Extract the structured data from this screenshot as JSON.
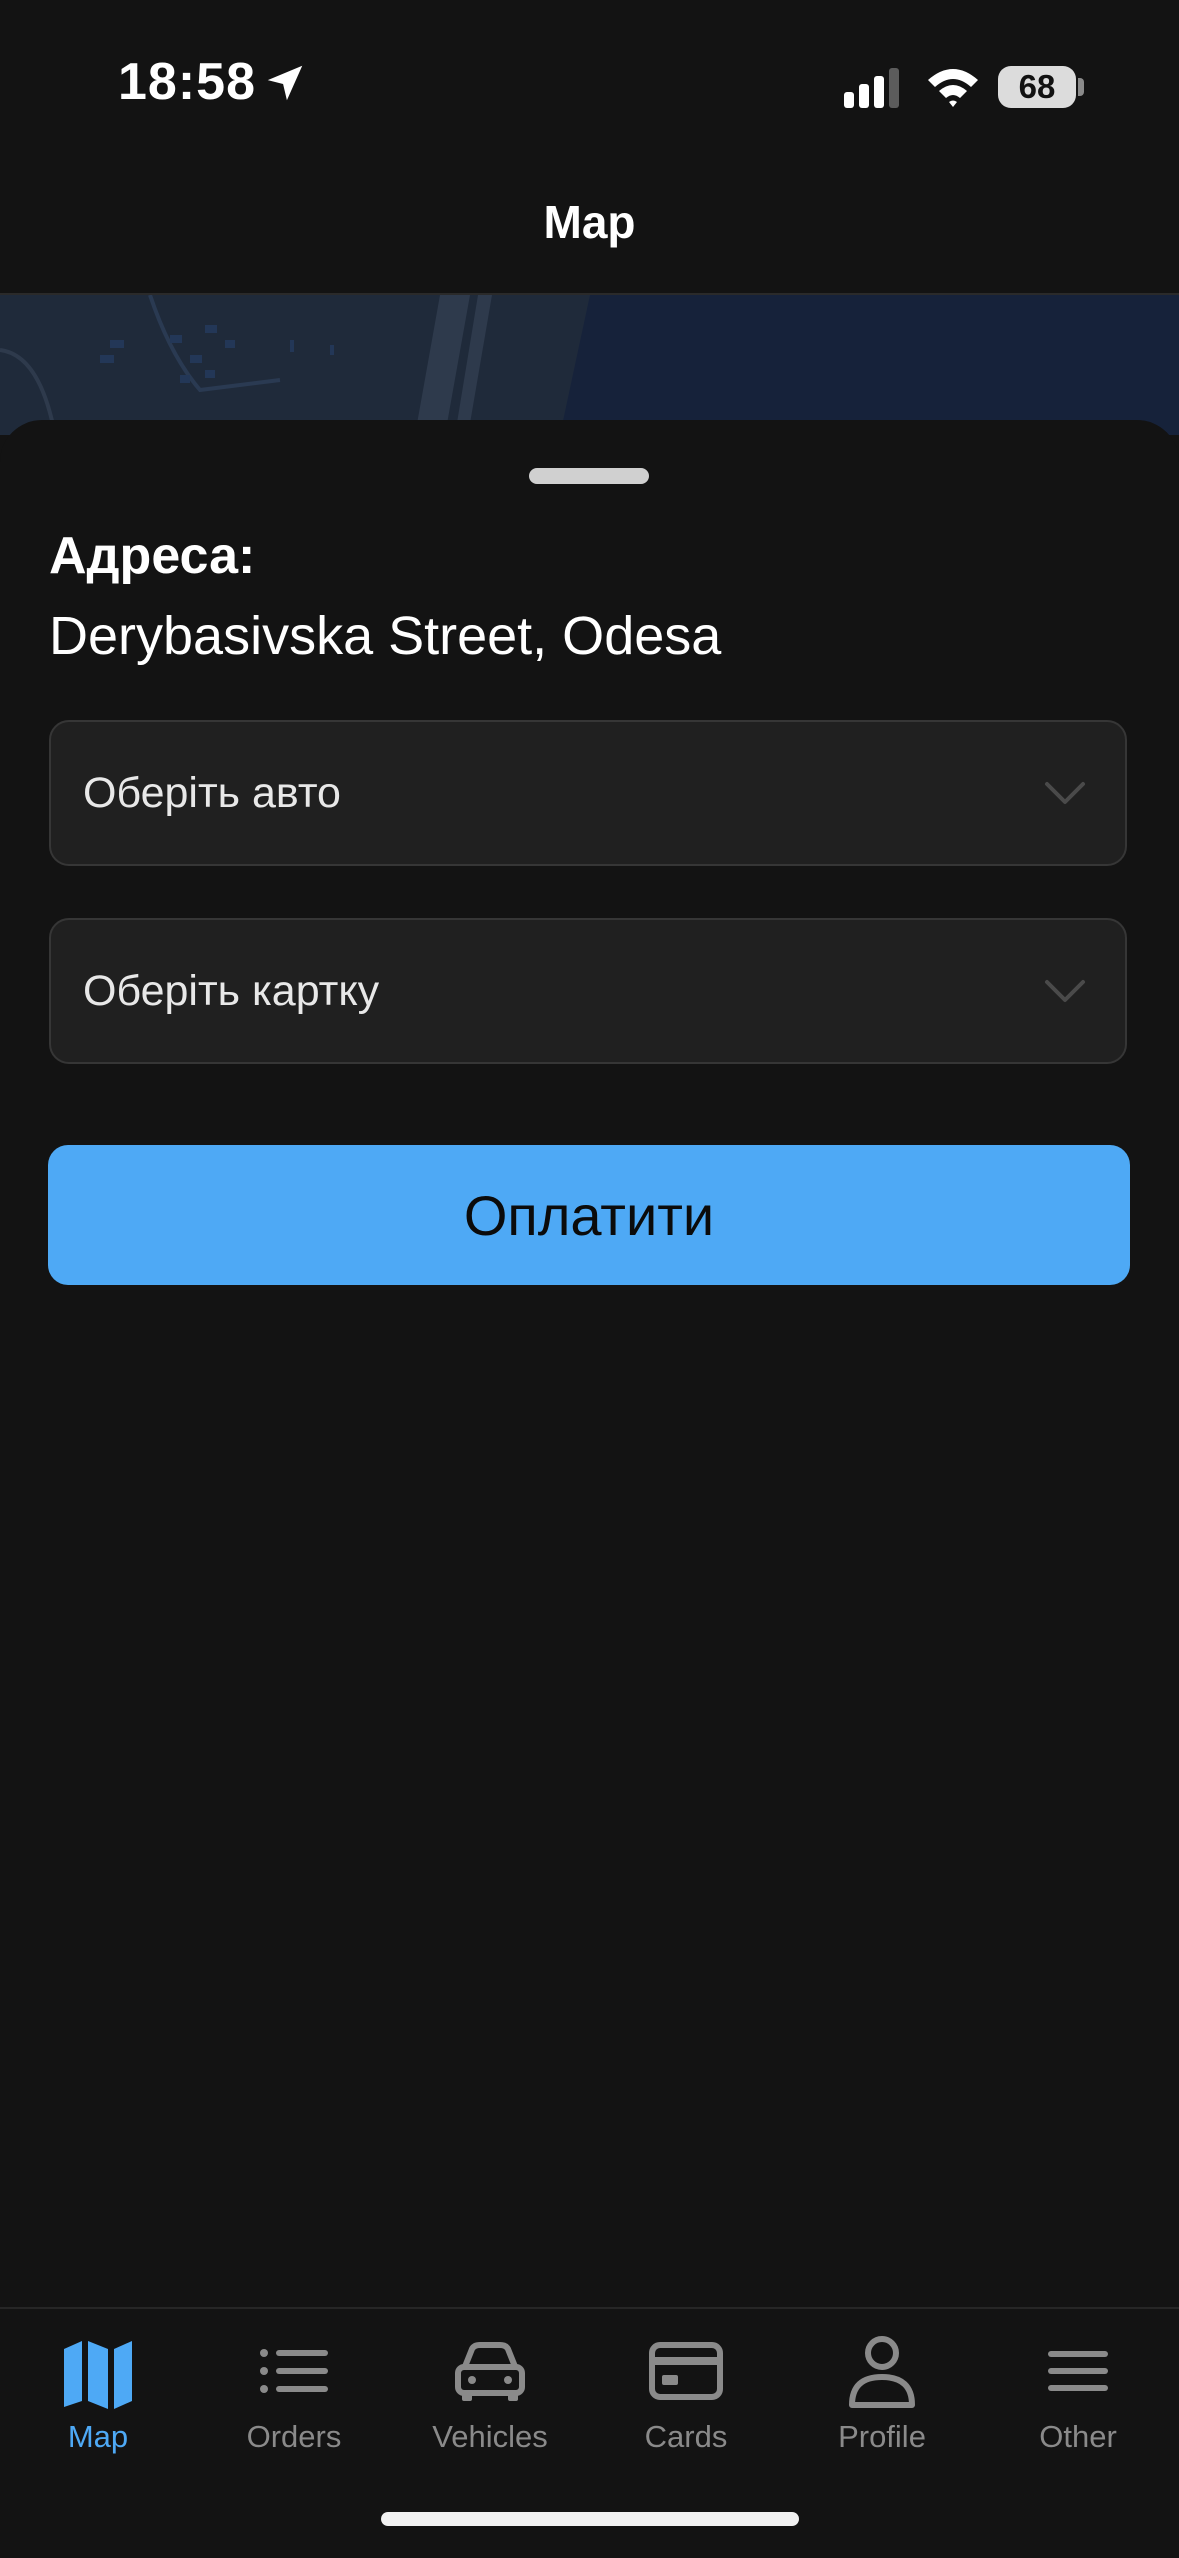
{
  "status_bar": {
    "time": "18:58",
    "battery": "68",
    "icons": [
      "location-arrow-icon",
      "cellular-signal-icon",
      "wifi-icon",
      "battery-icon"
    ]
  },
  "header": {
    "title": "Map"
  },
  "sheet": {
    "address_label": "Адреса:",
    "address_value": "Derybasivska Street, Odesa",
    "vehicle_select": {
      "value": "Оберіть авто",
      "icon": "chevron-down-icon"
    },
    "card_select": {
      "value": "Оберіть картку",
      "icon": "chevron-down-icon"
    },
    "pay_button": "Оплатити"
  },
  "tabs": [
    {
      "label": "Map",
      "icon": "map-icon",
      "active": true
    },
    {
      "label": "Orders",
      "icon": "list-icon",
      "active": false
    },
    {
      "label": "Vehicles",
      "icon": "car-icon",
      "active": false
    },
    {
      "label": "Cards",
      "icon": "credit-card-icon",
      "active": false
    },
    {
      "label": "Profile",
      "icon": "person-icon",
      "active": false
    },
    {
      "label": "Other",
      "icon": "menu-icon",
      "active": false
    }
  ],
  "colors": {
    "background": "#131313",
    "accent": "#4ea9f5",
    "field": "#202020",
    "inactive_tab": "#8a8a8a",
    "map_water": "#16223a"
  }
}
